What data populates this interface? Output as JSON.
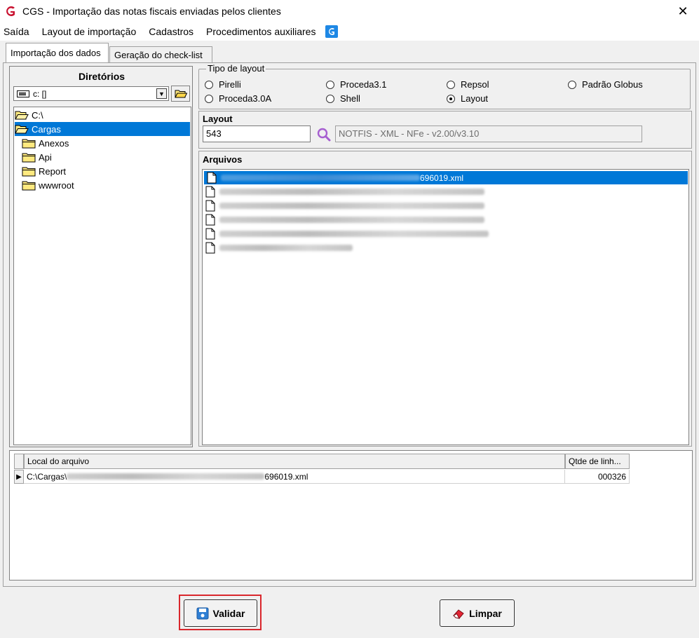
{
  "window": {
    "title": "CGS - Importação das notas fiscais enviadas pelos clientes",
    "close_glyph": "✕"
  },
  "menu": {
    "items": [
      "Saída",
      "Layout de importação",
      "Cadastros",
      "Procedimentos auxiliares"
    ]
  },
  "tabs": [
    {
      "label": "Importação dos dados",
      "active": true
    },
    {
      "label": "Geração do check-list",
      "active": false
    }
  ],
  "directories": {
    "title": "Diretórios",
    "drive": "c: []",
    "tree": [
      {
        "label": "C:\\",
        "level": 0,
        "open": true,
        "selected": false
      },
      {
        "label": "Cargas",
        "level": 0,
        "open": true,
        "selected": true
      },
      {
        "label": "Anexos",
        "level": 1,
        "open": false,
        "selected": false
      },
      {
        "label": "Api",
        "level": 1,
        "open": false,
        "selected": false
      },
      {
        "label": "Report",
        "level": 1,
        "open": false,
        "selected": false
      },
      {
        "label": "wwwroot",
        "level": 1,
        "open": false,
        "selected": false
      }
    ]
  },
  "layout_type": {
    "legend": "Tipo de layout",
    "options": [
      {
        "label": "Pirelli",
        "checked": false
      },
      {
        "label": "Proceda3.1",
        "checked": false
      },
      {
        "label": "Repsol",
        "checked": false
      },
      {
        "label": "Padrão Globus",
        "checked": false
      },
      {
        "label": "Proceda3.0A",
        "checked": false
      },
      {
        "label": "Shell",
        "checked": false
      },
      {
        "label": "Layout",
        "checked": true
      }
    ]
  },
  "layout": {
    "label": "Layout",
    "code": "543",
    "description": "NOTFIS - XML - NFe - v2.00/v3.10"
  },
  "files": {
    "label": "Arquivos",
    "items": [
      {
        "suffix": "696019.xml",
        "selected": true
      },
      {
        "suffix": "",
        "selected": false
      },
      {
        "suffix": "",
        "selected": false
      },
      {
        "suffix": "",
        "selected": false
      },
      {
        "suffix": "",
        "selected": false
      },
      {
        "suffix": "",
        "selected": false
      }
    ]
  },
  "grid": {
    "columns": [
      "Local do arquivo",
      "Qtde de linh..."
    ],
    "rows": [
      {
        "path_prefix": "C:\\Cargas\\",
        "path_suffix": "696019.xml",
        "lines": "000326"
      }
    ]
  },
  "buttons": {
    "validar": "Validar",
    "limpar": "Limpar"
  },
  "colors": {
    "selection": "#0078d7",
    "highlight_outline": "#d9262c",
    "brand_red": "#c8102e",
    "brand_blue": "#1e88e5"
  }
}
